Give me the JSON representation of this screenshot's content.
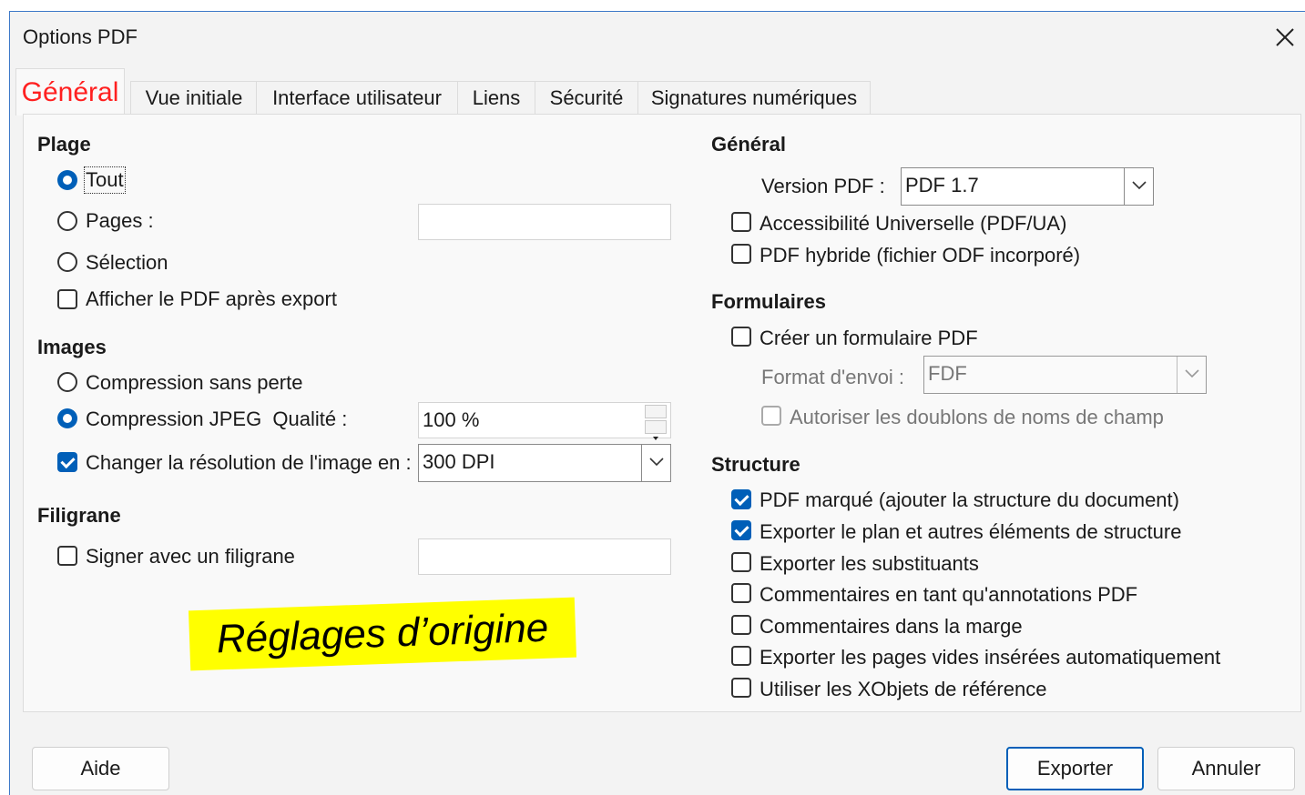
{
  "window": {
    "title": "Options PDF"
  },
  "tabs": [
    "Général",
    "Vue initiale",
    "Interface utilisateur",
    "Liens",
    "Sécurité",
    "Signatures numériques"
  ],
  "left": {
    "range": {
      "title": "Plage",
      "all": "Tout",
      "pages": "Pages :",
      "pages_value": "",
      "selection": "Sélection",
      "show_after_export": "Afficher le PDF après export"
    },
    "images": {
      "title": "Images",
      "lossless": "Compression sans perte",
      "jpeg": "Compression JPEG  Qualité :",
      "quality_value": "100 %",
      "reduce_resolution": "Changer la résolution de l'image en :",
      "resolution_value": "300 DPI"
    },
    "watermark": {
      "title": "Filigrane",
      "sign": "Signer avec un filigrane",
      "value": ""
    }
  },
  "right": {
    "general": {
      "title": "Général",
      "version_label": "Version PDF :",
      "version_value": "PDF 1.7",
      "pdfua": "Accessibilité Universelle (PDF/UA)",
      "hybrid": "PDF hybride (fichier ODF incorporé)"
    },
    "forms": {
      "title": "Formulaires",
      "create": "Créer un formulaire PDF",
      "format_label": "Format d'envoi :",
      "format_value": "FDF",
      "allow_duplicates": "Autoriser les doublons de noms de champ"
    },
    "structure": {
      "title": "Structure",
      "items": [
        "PDF marqué (ajouter la structure du document)",
        "Exporter le plan et autres éléments de structure",
        "Exporter les substituants",
        "Commentaires en tant qu'annotations PDF",
        "Commentaires dans la marge",
        "Exporter les pages vides insérées automatiquement",
        "Utiliser les XObjets de référence"
      ]
    }
  },
  "annotation": "Réglages d’origine",
  "buttons": {
    "help": "Aide",
    "export": "Exporter",
    "cancel": "Annuler"
  },
  "colors": {
    "accent": "#005fb8",
    "active_tab": "#ff2020",
    "highlight": "#ffff00"
  }
}
